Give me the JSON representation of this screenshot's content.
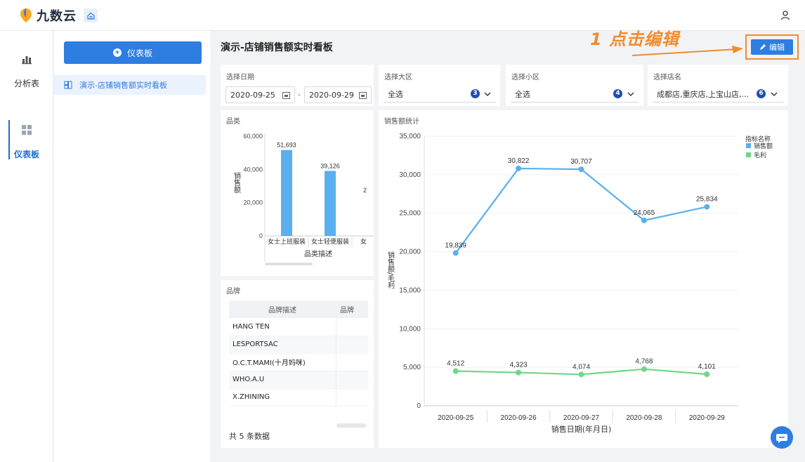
{
  "app": {
    "logo_text": "九数云"
  },
  "rail": {
    "items": [
      {
        "label": "分析表",
        "icon": "bar-chart-icon"
      },
      {
        "label": "仪表板",
        "icon": "dashboard-icon",
        "active": true
      }
    ]
  },
  "tree": {
    "add_button": "仪表板",
    "items": [
      {
        "label": "演示-店铺销售额实时看板",
        "icon": "dashboard-file-icon"
      }
    ]
  },
  "main": {
    "title": "演示-店铺销售额实时看板",
    "annotation": "1 点击编辑",
    "edit_button": "编辑"
  },
  "filters": {
    "date": {
      "label": "选择日期",
      "start": "2020-09-25",
      "separator": "-",
      "end": "2020-09-29"
    },
    "region": {
      "label": "选择大区",
      "value": "全选",
      "badge": "3"
    },
    "subregion": {
      "label": "选择小区",
      "value": "全选",
      "badge": "4"
    },
    "store": {
      "label": "选择店名",
      "value": "成都店,重庆店,上宝山店,...",
      "badge": "6"
    }
  },
  "category_chart": {
    "title": "品类",
    "ylabel": "销售额",
    "xlabel": "品类描述",
    "cut_label_right": "2",
    "cut_category": "女",
    "chart_data": {
      "type": "bar",
      "categories": [
        "女士上班服装",
        "女士轻便服装"
      ],
      "values": [
        51693,
        39126
      ],
      "value_labels": [
        "51,693",
        "39,126"
      ],
      "ylim": [
        0,
        60000
      ],
      "yticks": [
        "0",
        "20,000",
        "40,000",
        "60,000"
      ],
      "color": "#5ab0ee"
    }
  },
  "brand_table": {
    "title": "品牌",
    "columns": [
      "品牌描述",
      "品牌"
    ],
    "rows": [
      "HANG TEN",
      "LESPORTSAC",
      "O.C.T.MAMI(十月妈咪)",
      "WHO.A.U",
      "X.ZHINING"
    ],
    "footer": "共 5 条数据"
  },
  "sales_chart": {
    "title": "销售额统计",
    "ylabel": "销售额/毛利",
    "xlabel": "销售日期(年月日)",
    "legend_title": "指标名称",
    "chart_data": {
      "type": "line",
      "x": [
        "2020-09-25",
        "2020-09-26",
        "2020-09-27",
        "2020-09-28",
        "2020-09-29"
      ],
      "ylim": [
        0,
        35000
      ],
      "yticks": [
        "0",
        "5,000",
        "10,000",
        "15,000",
        "20,000",
        "25,000",
        "30,000",
        "35,000"
      ],
      "series": [
        {
          "name": "销售额",
          "values": [
            19839,
            30822,
            30707,
            24065,
            25834
          ],
          "labels": [
            "19,839",
            "30,822",
            "30,707",
            "24,065",
            "25,834"
          ],
          "color": "#5ab0ee"
        },
        {
          "name": "毛利",
          "values": [
            4512,
            4323,
            4074,
            4768,
            4101
          ],
          "labels": [
            "4,512",
            "4,323",
            "4,074",
            "4,768",
            "4,101"
          ],
          "color": "#6fd68a"
        }
      ],
      "legend": "right"
    }
  }
}
